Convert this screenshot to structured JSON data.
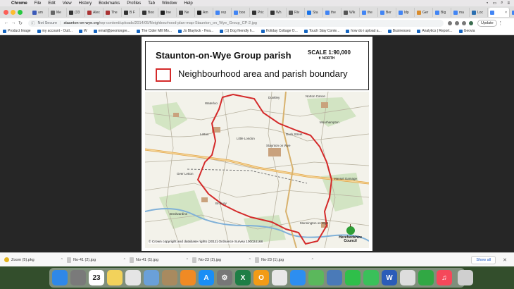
{
  "menubar": {
    "items": [
      "Chrome",
      "File",
      "Edit",
      "View",
      "History",
      "Bookmarks",
      "Profiles",
      "Tab",
      "Window",
      "Help"
    ]
  },
  "tabs": [
    {
      "label": "am",
      "color": "#3b5ab8"
    },
    {
      "label": "Me",
      "color": "#666666"
    },
    {
      "label": "(33",
      "color": "#333333"
    },
    {
      "label": "Alex",
      "color": "#aa3333"
    },
    {
      "label": "The",
      "color": "#aa3333"
    },
    {
      "label": "B F",
      "color": "#333333"
    },
    {
      "label": "Boo",
      "color": "#333333"
    },
    {
      "label": "Ine",
      "color": "#222222"
    },
    {
      "label": "Ne",
      "color": "#444444"
    },
    {
      "label": "Am",
      "color": "#222222"
    },
    {
      "label": "rep",
      "color": "#4285f4"
    },
    {
      "label": "boo",
      "color": "#4285f4"
    },
    {
      "label": "Pric",
      "color": "#333333"
    },
    {
      "label": "Wh",
      "color": "#333333"
    },
    {
      "label": "Riv",
      "color": "#555555"
    },
    {
      "label": "Sta",
      "color": "#1a73e8"
    },
    {
      "label": "the",
      "color": "#4285f4"
    },
    {
      "label": "Wik",
      "color": "#555555"
    },
    {
      "label": "the",
      "color": "#4285f4"
    },
    {
      "label": "Ber",
      "color": "#4285f4"
    },
    {
      "label": "ldp",
      "color": "#4285f4"
    },
    {
      "label": "Ger",
      "color": "#d98b2b"
    },
    {
      "label": "Big",
      "color": "#4285f4"
    },
    {
      "label": "ma",
      "color": "#4285f4"
    },
    {
      "label": "Loc",
      "color": "#2a6fb0"
    },
    {
      "label": "",
      "color": "#4285f4",
      "active": true
    },
    {
      "label": "hov",
      "color": "#4285f4"
    }
  ],
  "toolbar": {
    "not_secure": "Not Secure",
    "url_domain": "staunton-on-wye.org",
    "url_path": "/wp-content/uploads/2014/05/Neighbourhood-plan-map-Staunton_on_Wye_Group_CP-2.jpg",
    "update_label": "Update"
  },
  "bookmarks": [
    "Product Image",
    "my account - Outl...",
    "W",
    "email@peoriongre...",
    "The Cider Mill Mo...",
    "Jo Blaylock - Hea...",
    "(1) Dog friendly h...",
    "Holiday Cottage O...",
    "Touch Stay Conte...",
    "how do i upload a...",
    "Businesses",
    "Analytics | Report...",
    "Geovia"
  ],
  "map": {
    "title": "Staunton-on-Wye Group parish",
    "scale": "SCALE 1:90,000",
    "north": "NORTH",
    "legend_label": "Neighbourhood area and parish boundary",
    "boundary_color": "#d42a2a",
    "copyright": "© Crown copyright and database rights (2012) Ordnance Survey 100024168",
    "council_line1": "Herefordshire",
    "council_line2": "Council",
    "places": [
      "Waterloo",
      "Letton",
      "Little London",
      "Staunton on Wye",
      "Norton Canon",
      "Moorhampton",
      "Mansel Gamage",
      "Bredwardine",
      "Brobury",
      "Monnington on Wye",
      "Over Letton",
      "Dunkley",
      "Duck Street"
    ]
  },
  "downloads": [
    {
      "name": "Zoom (5).pkg",
      "icon": "zoom"
    },
    {
      "name": "No-41 (2).jpg",
      "icon": "file"
    },
    {
      "name": "No-41 (1).jpg",
      "icon": "file"
    },
    {
      "name": "No-23 (2).jpg",
      "icon": "file"
    },
    {
      "name": "No-23 (1).jpg",
      "icon": "file"
    }
  ],
  "downloads_bar": {
    "show_all": "Show all",
    "close": "✕"
  },
  "dock": {
    "apps": [
      {
        "name": "finder",
        "color": "#2f88e8",
        "glyph": ""
      },
      {
        "name": "launchpad",
        "color": "#7a7a7a",
        "glyph": ""
      },
      {
        "name": "calendar",
        "color": "#ffffff",
        "glyph": "23"
      },
      {
        "name": "notes",
        "color": "#f2d25b",
        "glyph": ""
      },
      {
        "name": "photos",
        "color": "#e5e5e5",
        "glyph": ""
      },
      {
        "name": "preview",
        "color": "#6aa0d8",
        "glyph": ""
      },
      {
        "name": "contacts",
        "color": "#a88a5f",
        "glyph": ""
      },
      {
        "name": "books",
        "color": "#f08a24",
        "glyph": ""
      },
      {
        "name": "app-store",
        "color": "#1a8ef5",
        "glyph": "A"
      },
      {
        "name": "system-preferences",
        "color": "#777777",
        "glyph": "⚙"
      },
      {
        "name": "excel",
        "color": "#1e7e45",
        "glyph": "X"
      },
      {
        "name": "pages",
        "color": "#f29b16",
        "glyph": "O"
      },
      {
        "name": "chrome",
        "color": "#e8e8e8",
        "glyph": ""
      },
      {
        "name": "safari",
        "color": "#2d8ef0",
        "glyph": ""
      },
      {
        "name": "maps",
        "color": "#5bb85c",
        "glyph": ""
      },
      {
        "name": "image-capture",
        "color": "#4a7ab8",
        "glyph": ""
      },
      {
        "name": "facetime",
        "color": "#2fbf4a",
        "glyph": ""
      },
      {
        "name": "messages",
        "color": "#3ac05a",
        "glyph": ""
      },
      {
        "name": "word",
        "color": "#2b5cb8",
        "glyph": "W"
      },
      {
        "name": "keyboard-viewer",
        "color": "#dddddd",
        "glyph": ""
      },
      {
        "name": "numbers",
        "color": "#31a844",
        "glyph": ""
      },
      {
        "name": "music",
        "color": "#f5485a",
        "glyph": "♫"
      },
      {
        "name": "trash",
        "color": "#cfcfcf",
        "glyph": ""
      }
    ]
  }
}
